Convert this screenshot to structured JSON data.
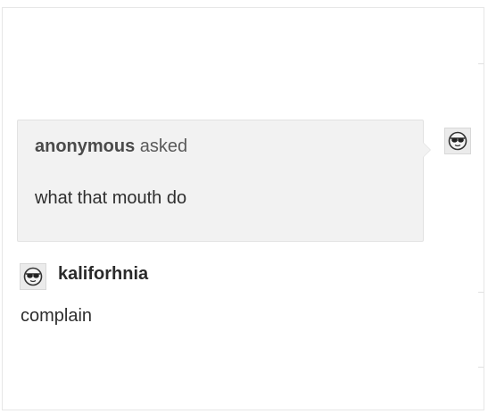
{
  "ask": {
    "asker_name": "anonymous",
    "asked_word": " asked",
    "question": "what that mouth do",
    "asker_avatar_icon": "sunglasses-face-icon"
  },
  "answer": {
    "answerer_name": "kaliforhnia",
    "answer_text": "complain",
    "answerer_avatar_icon": "sunglasses-face-icon"
  },
  "colors": {
    "ask_background": "#f2f2f2",
    "text_primary": "#2e2e2e",
    "text_secondary": "#5a5a5a"
  }
}
